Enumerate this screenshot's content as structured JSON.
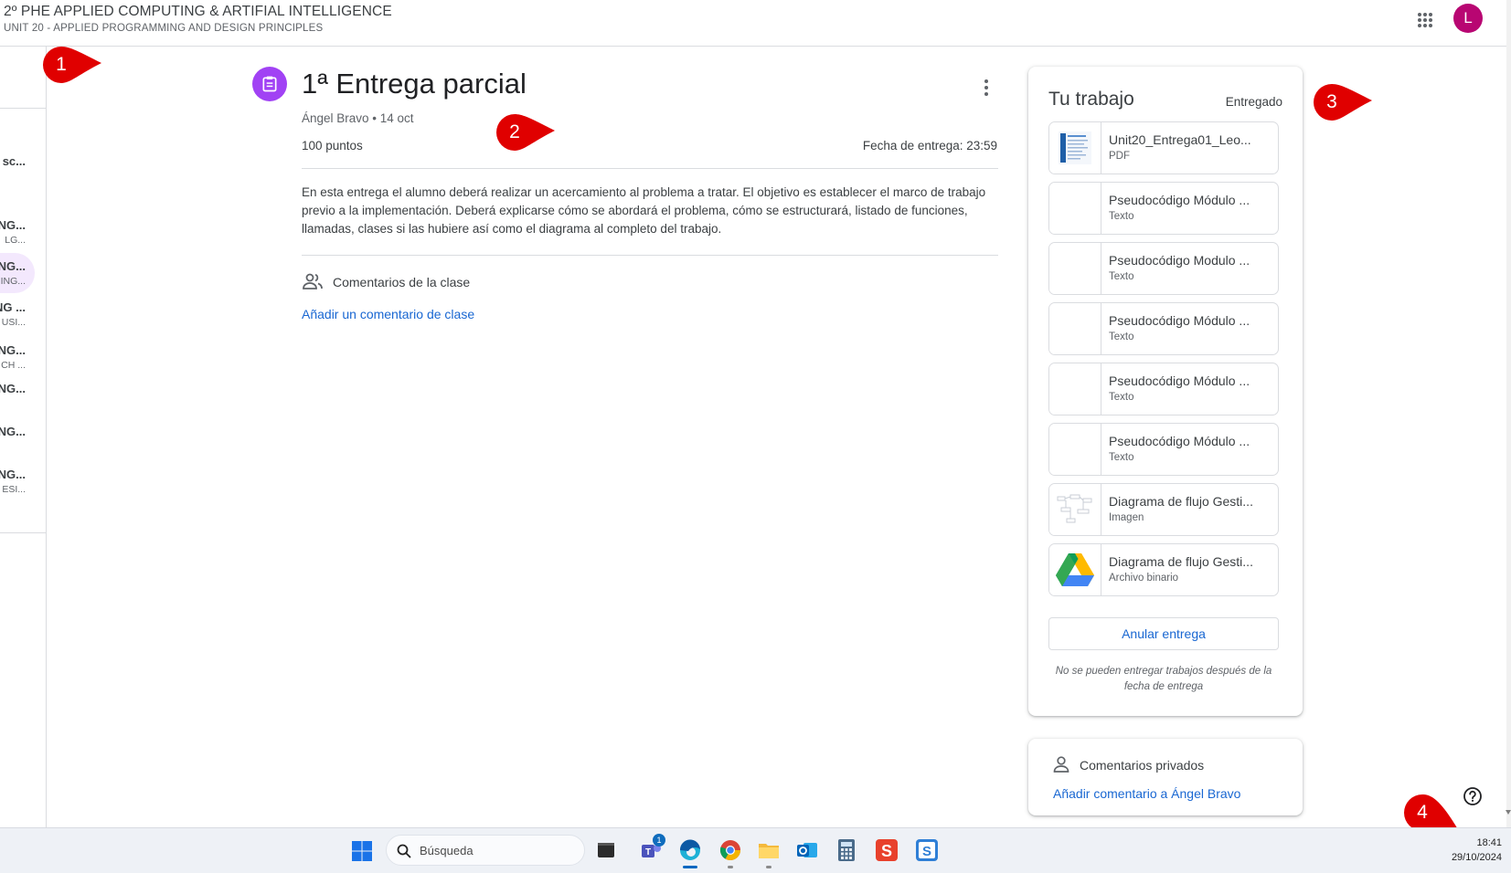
{
  "header": {
    "course_title": "2º PHE APPLIED COMPUTING & ARTIFIAL INTELLIGENCE",
    "course_subtitle": "UNIT 20 - APPLIED PROGRAMMING AND DESIGN PRINCIPLES",
    "apps_icon": "grid-apps-icon",
    "avatar_letter": "L",
    "avatar_color": "#b80672"
  },
  "sidebar": {
    "items": [
      {
        "line1": "sc...",
        "line2": ""
      },
      {
        "line1": "NG...",
        "line2": "LG..."
      },
      {
        "line1": "NG...",
        "line2": "ING...",
        "active": true
      },
      {
        "line1": "NG ...",
        "line2": "USI..."
      },
      {
        "line1": "NG...",
        "line2": "CH ..."
      },
      {
        "line1": "NG...",
        "line2": ""
      },
      {
        "line1": "NG...",
        "line2": ""
      },
      {
        "line1": "NG...",
        "line2": "ESI..."
      }
    ]
  },
  "assignment": {
    "icon": "assignment-icon",
    "accent_color": "#a142f4",
    "title": "1ª Entrega parcial",
    "meta": "Ángel Bravo • 14 oct",
    "points": "100 puntos",
    "due": "Fecha de entrega: 23:59",
    "description": "En esta entrega el alumno deberá realizar un acercamiento al problema a tratar. El objetivo es establecer el marco de trabajo previo a la implementación. Deberá explicarse cómo se abordará el problema, cómo se estructurará, listado de funciones, llamadas, clases si las hubiere así como el diagrama al completo del trabajo.",
    "class_comments_label": "Comentarios de la clase",
    "add_class_comment": "Añadir un comentario de clase"
  },
  "your_work": {
    "title": "Tu trabajo",
    "status": "Entregado",
    "attachments": [
      {
        "name": "Unit20_Entrega01_Leo...",
        "type": "PDF",
        "thumb": "pdf-thumbnail"
      },
      {
        "name": "Pseudocódigo Módulo ...",
        "type": "Texto",
        "thumb": "blank"
      },
      {
        "name": "Pseudocódigo Modulo ...",
        "type": "Texto",
        "thumb": "blank"
      },
      {
        "name": "Pseudocódigo Módulo ...",
        "type": "Texto",
        "thumb": "blank"
      },
      {
        "name": "Pseudocódigo Módulo ...",
        "type": "Texto",
        "thumb": "blank"
      },
      {
        "name": "Pseudocódigo Módulo ...",
        "type": "Texto",
        "thumb": "blank"
      },
      {
        "name": "Diagrama de flujo Gesti...",
        "type": "Imagen",
        "thumb": "image-thumbnail"
      },
      {
        "name": "Diagrama de flujo Gesti...",
        "type": "Archivo binario",
        "thumb": "google-drive-icon"
      }
    ],
    "unsubmit_button": "Anular entrega",
    "note": "No se pueden entregar trabajos después de la fecha de entrega"
  },
  "private_comments": {
    "title": "Comentarios privados",
    "add_link": "Añadir comentario a Ángel Bravo"
  },
  "markers": [
    {
      "label": "1",
      "color": "#e00000"
    },
    {
      "label": "2",
      "color": "#e00000"
    },
    {
      "label": "3",
      "color": "#e00000"
    },
    {
      "label": "4",
      "color": "#e00000"
    }
  ],
  "taskbar": {
    "search_placeholder": "Búsqueda",
    "teams_badge": "1",
    "time": "18:41",
    "date": "29/10/2024",
    "apps": [
      "terminal-icon",
      "teams-icon",
      "edge-icon",
      "chrome-icon",
      "file-explorer-icon",
      "outlook-icon",
      "calculator-icon",
      "app-s-red-icon",
      "app-s-blue-icon"
    ]
  }
}
